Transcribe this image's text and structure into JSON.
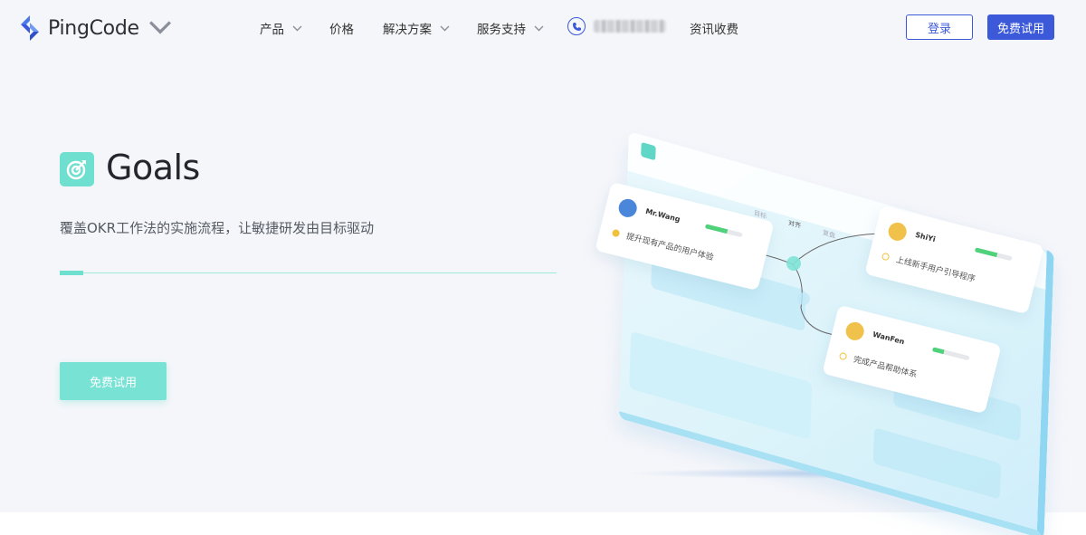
{
  "header": {
    "logo_text": "PingCode",
    "nav": [
      {
        "label": "产品",
        "has_dropdown": true
      },
      {
        "label": "价格",
        "has_dropdown": false
      },
      {
        "label": "解决方案",
        "has_dropdown": true
      },
      {
        "label": "服务支持",
        "has_dropdown": true
      }
    ],
    "news_label": "资讯收费",
    "login_label": "登录",
    "trial_label": "免费试用"
  },
  "hero": {
    "title": "Goals",
    "subtitle": "覆盖OKR工作法的实施流程，让敏捷研发由目标驱动",
    "progress_fraction": 0.047,
    "cta_label": "免费试用"
  },
  "illustration": {
    "tabs": [
      "目标",
      "对齐",
      "复盘"
    ],
    "cards": [
      {
        "name": "Mr.Wang",
        "task": "提升现有产品的用户体验",
        "progress": 0.6,
        "avatar_color": "#4a86d9",
        "dot_color": "#f0c23b",
        "dot_filled": true
      },
      {
        "name": "ShiYi",
        "task": "上线新手用户引导程序",
        "progress": 0.6,
        "avatar_color": "#f1c24b",
        "dot_color": "#f0c23b",
        "dot_filled": false
      },
      {
        "name": "WanFen",
        "task": "完成产品帮助体系",
        "progress": 0.3,
        "avatar_color": "#f1c24b",
        "dot_color": "#f0c23b",
        "dot_filled": false
      }
    ]
  },
  "colors": {
    "brand_blue": "#3b59d8",
    "goals_teal": "#6fdfd0",
    "page_bg": "#f5f6fa"
  }
}
